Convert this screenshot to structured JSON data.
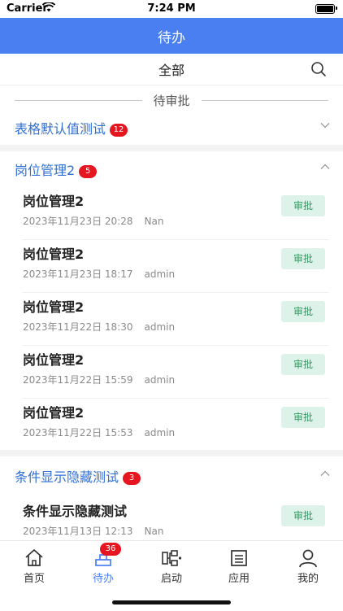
{
  "status_bar": {
    "carrier": "Carrier",
    "time": "7:24 PM"
  },
  "nav": {
    "title": "待办"
  },
  "filter": {
    "label": "全部"
  },
  "section": {
    "title": "待审批"
  },
  "groups": [
    {
      "name": "表格默认值测试",
      "count": "12",
      "expanded": false
    },
    {
      "name": "岗位管理2",
      "count": "5",
      "expanded": true
    },
    {
      "name": "条件显示隐藏测试",
      "count": "3",
      "expanded": true
    }
  ],
  "items": [
    {
      "title": "岗位管理2",
      "datetime": "2023年11月23日 20:28",
      "user": "Nan",
      "action": "审批"
    },
    {
      "title": "岗位管理2",
      "datetime": "2023年11月23日 18:17",
      "user": "admin",
      "action": "审批"
    },
    {
      "title": "岗位管理2",
      "datetime": "2023年11月22日 18:30",
      "user": "admin",
      "action": "审批"
    },
    {
      "title": "岗位管理2",
      "datetime": "2023年11月22日 15:59",
      "user": "admin",
      "action": "审批"
    },
    {
      "title": "岗位管理2",
      "datetime": "2023年11月22日 15:53",
      "user": "admin",
      "action": "审批"
    },
    {
      "title": "条件显示隐藏测试",
      "datetime": "2023年11月13日 12:13",
      "user": "Nan",
      "action": "审批"
    }
  ],
  "tabbar": {
    "tabs": [
      {
        "label": "首页",
        "icon": "home-icon"
      },
      {
        "label": "待办",
        "icon": "todo-icon",
        "badge": "36",
        "active": true
      },
      {
        "label": "启动",
        "icon": "flow-icon"
      },
      {
        "label": "应用",
        "icon": "apps-icon"
      },
      {
        "label": "我的",
        "icon": "user-icon"
      }
    ]
  },
  "colors": {
    "primary": "#4a7ff2",
    "badge": "#e5161f",
    "approve_bg": "#ddf2e8",
    "approve_text": "#2e9c61",
    "group_text": "#2f6fd6"
  }
}
